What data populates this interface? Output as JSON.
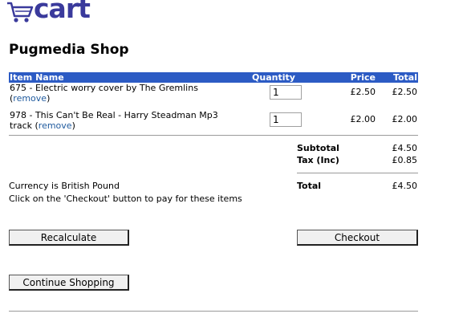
{
  "header": {
    "logo_text": "cart",
    "logo_icon": "shopping-cart-icon",
    "shop_title": "Pugmedia Shop"
  },
  "table": {
    "headers": {
      "name": "Item Name",
      "quantity": "Quantity",
      "price": "Price",
      "total": "Total"
    },
    "items": [
      {
        "name": "675 - Electric worry cover by The Gremlins",
        "remove_label": "remove",
        "quantity": "1",
        "price": "£2.50",
        "total": "£2.50"
      },
      {
        "name": "978 - This Can't Be Real - Harry Steadman Mp3 track",
        "remove_label": "remove",
        "quantity": "1",
        "price": "£2.00",
        "total": "£2.00"
      }
    ]
  },
  "summary": {
    "subtotal_label": "Subtotal",
    "subtotal_value": "£4.50",
    "tax_label": "Tax (Inc)",
    "tax_value": "£0.85",
    "total_label": "Total",
    "total_value": "£4.50"
  },
  "messages": {
    "currency": "Currency is British Pound",
    "checkout_hint": "Click on the 'Checkout' button to pay for these items"
  },
  "buttons": {
    "recalculate": "Recalculate",
    "checkout": "Checkout",
    "continue_shopping": "Continue Shopping"
  },
  "colors": {
    "header_bg": "#2c5bc4",
    "link": "#1f5a9e",
    "logo_text": "#3a3a9c",
    "logo_accent": "#f5c400"
  }
}
